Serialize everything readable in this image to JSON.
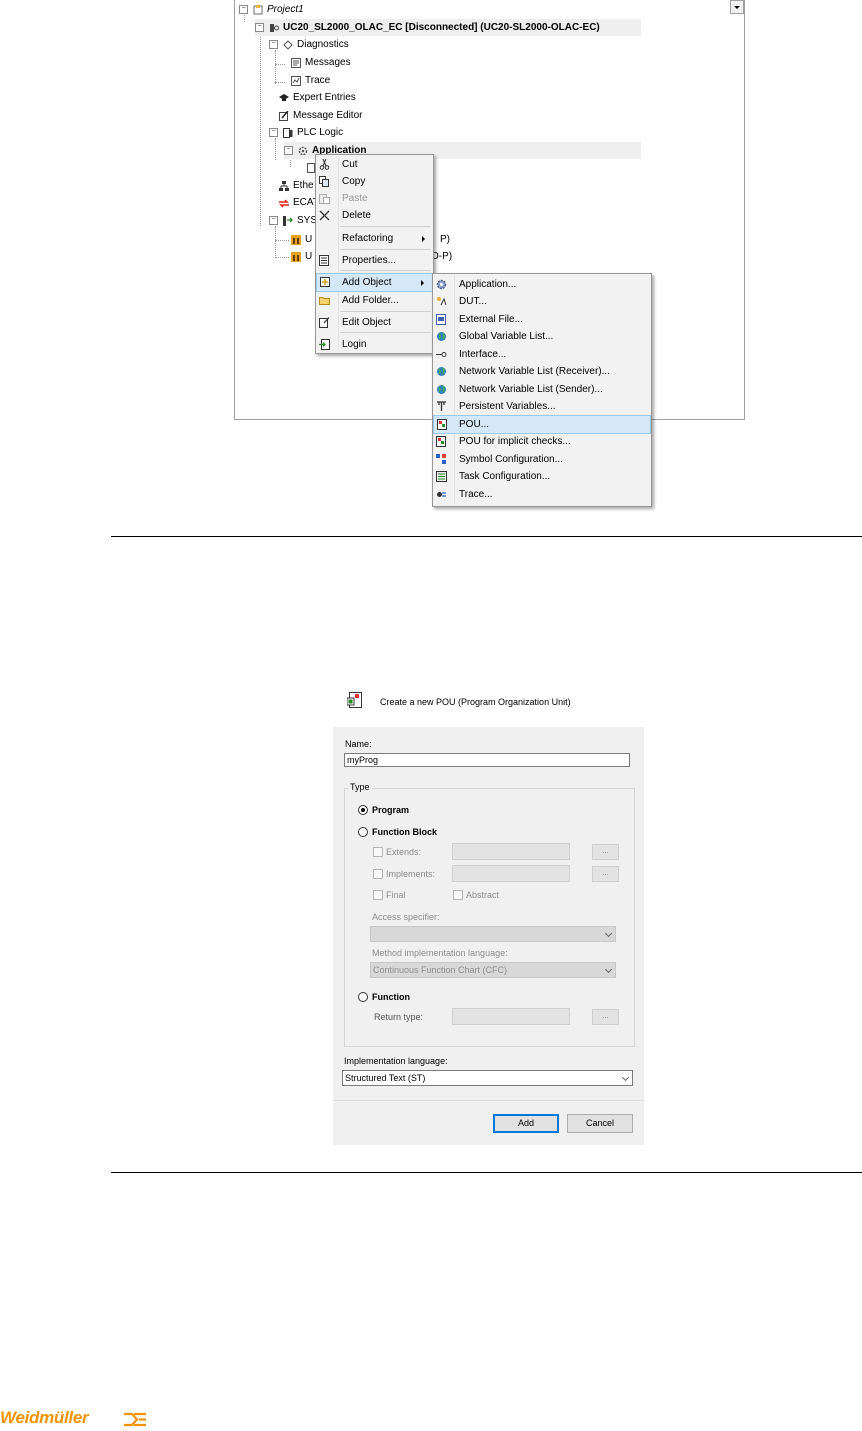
{
  "tree": {
    "rows": [
      {
        "label": "Project1",
        "style": "italic"
      },
      {
        "label": "UC20_SL2000_OLAC_EC [Disconnected] (UC20-SL2000-OLAC-EC)",
        "style": "bold"
      },
      {
        "label": "Diagnostics"
      },
      {
        "label": "Messages"
      },
      {
        "label": "Trace"
      },
      {
        "label": "Expert Entries"
      },
      {
        "label": "Message Editor"
      },
      {
        "label": "PLC Logic"
      },
      {
        "label": "Application",
        "style": "bold"
      },
      {
        "label": "Ethe"
      },
      {
        "label": "ECAT"
      },
      {
        "label": "SYSI"
      },
      {
        "label": "U",
        "suffix": "P)"
      },
      {
        "label": "U",
        "suffix": "O-P)"
      }
    ]
  },
  "context_menu": {
    "items": [
      "Cut",
      "Copy",
      "Paste",
      "Delete",
      "Refactoring",
      "Properties...",
      "Add Object",
      "Add Folder...",
      "Edit Object",
      "Login"
    ]
  },
  "submenu": {
    "items": [
      "Application...",
      "DUT...",
      "External File...",
      "Global Variable List...",
      "Interface...",
      "Network Variable List (Receiver)...",
      "Network Variable List (Sender)...",
      "Persistent Variables...",
      "POU...",
      "POU for implicit checks...",
      "Symbol Configuration...",
      "Task Configuration...",
      "Trace..."
    ],
    "highlighted": "POU..."
  },
  "dialog": {
    "heading": "Create a new POU (Program Organization Unit)",
    "name_label": "Name:",
    "name_value": "myProg",
    "type_label": "Type",
    "program": "Program",
    "function_block": "Function Block",
    "extends": "Extends:",
    "implements": "Implements:",
    "final": "Final",
    "abstract": "Abstract",
    "access_specifier": "Access specifier:",
    "method_lang_label": "Method implementation language:",
    "method_lang_value": "Continuous Function Chart (CFC)",
    "function": "Function",
    "return_type": "Return type:",
    "dots": "...",
    "impl_lang_label": "Implementation language:",
    "impl_lang_value": "Structured Text (ST)",
    "add": "Add",
    "cancel": "Cancel",
    "selected_type": "Program"
  },
  "logo": {
    "text": "Weidmüller",
    "color": "#f29400"
  },
  "colors": {
    "highlight": "#d5e8f7",
    "accent": "#0078d7"
  }
}
